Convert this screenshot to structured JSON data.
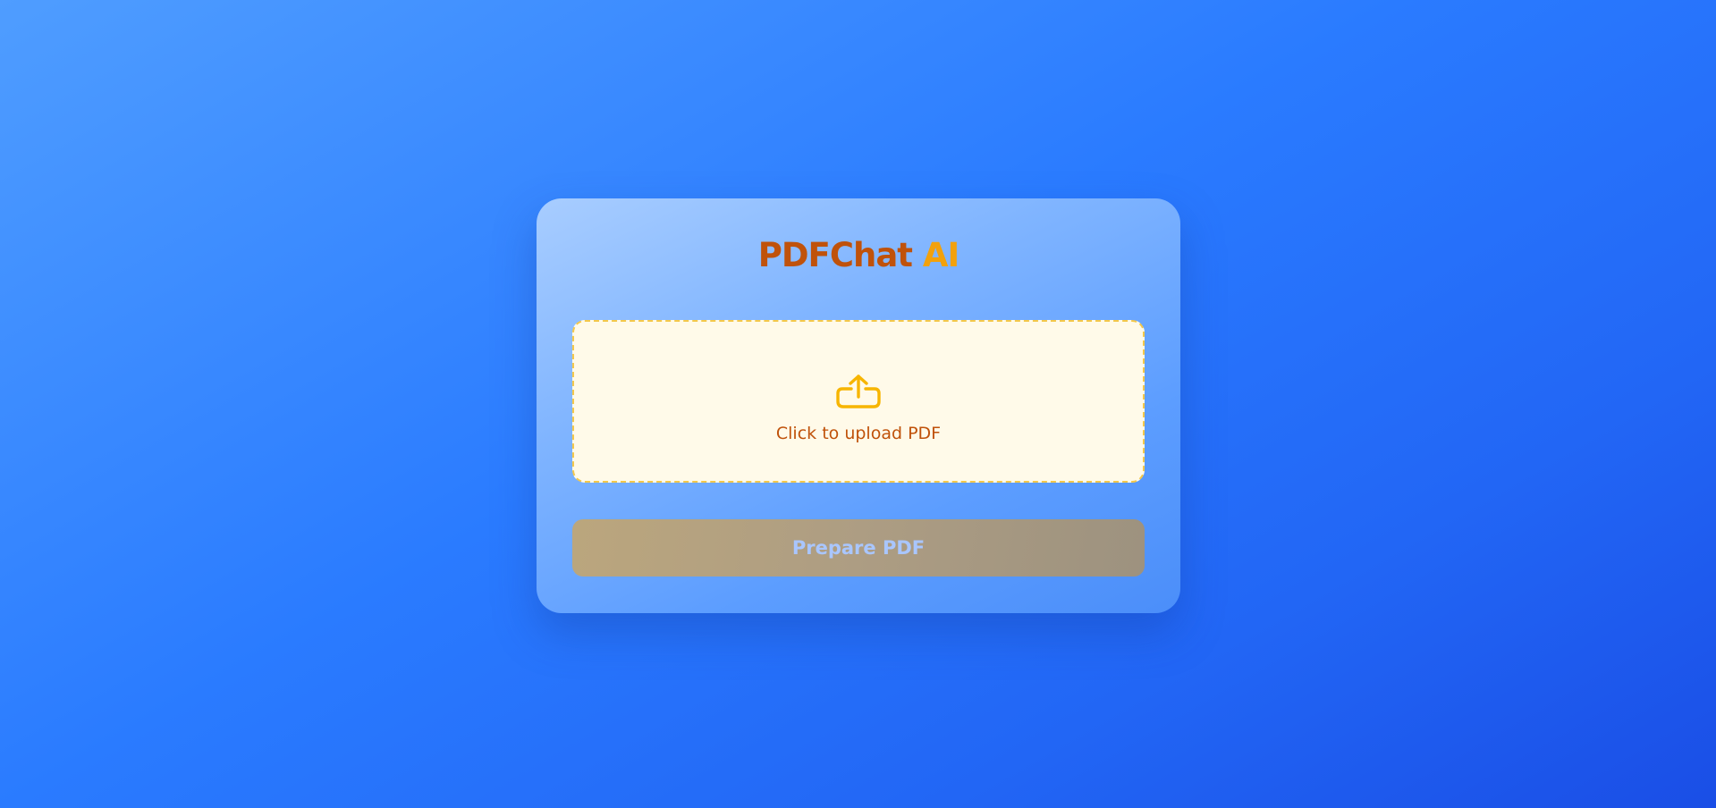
{
  "app": {
    "title_brand": "PDFChat",
    "title_accent": "AI"
  },
  "upload": {
    "icon": "upload-icon",
    "label": "Click to upload PDF"
  },
  "actions": {
    "prepare_label": "Prepare PDF",
    "prepare_enabled": false
  },
  "colors": {
    "brand": "#c0520a",
    "accent": "#f2a10c",
    "dropzone_border": "#f4c84a",
    "dropzone_bg": "#fffae9"
  }
}
